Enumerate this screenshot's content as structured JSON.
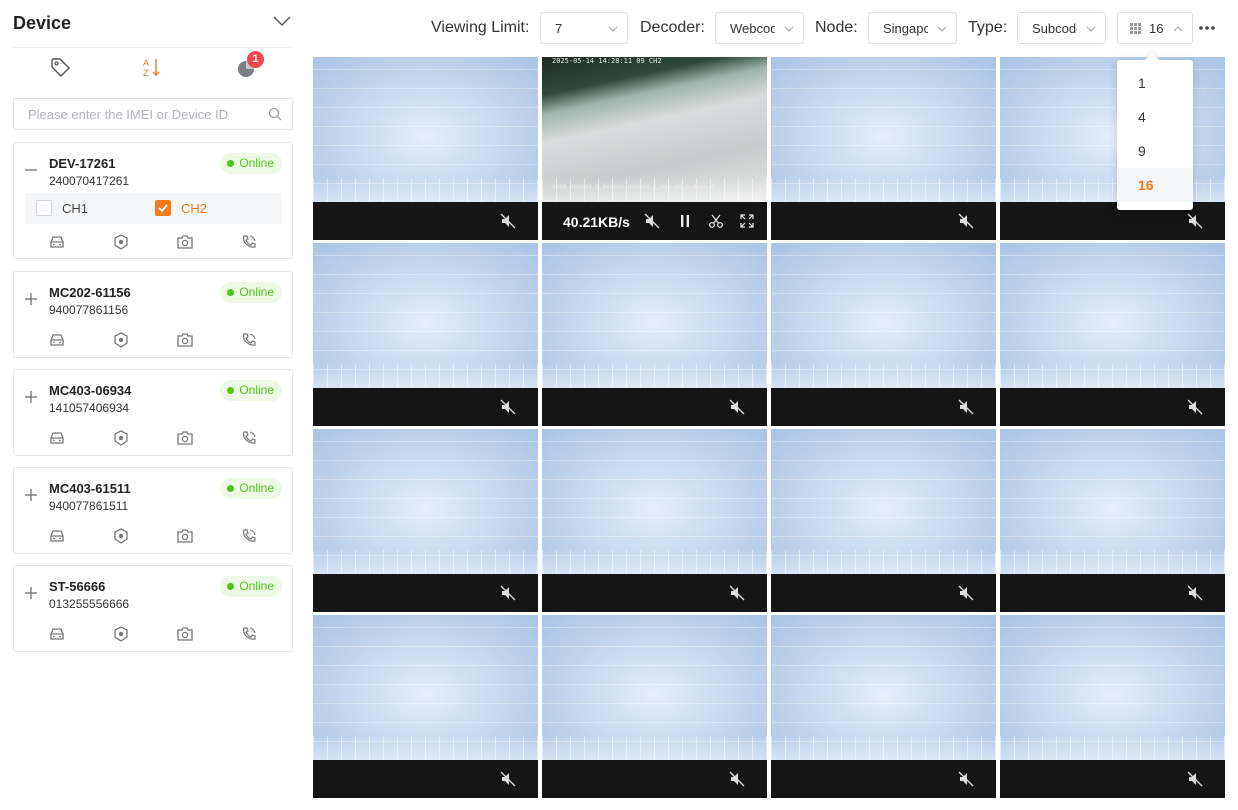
{
  "sidebar": {
    "title": "Device",
    "notification_count": "1",
    "search_placeholder": "Please enter the IMEI or Device ID",
    "devices": [
      {
        "name": "DEV-17261",
        "id": "240070417261",
        "status": "Online",
        "expanded": true,
        "channels": [
          {
            "label": "CH1",
            "checked": false
          },
          {
            "label": "CH2",
            "checked": true
          }
        ]
      },
      {
        "name": "MC202-61156",
        "id": "940077861156",
        "status": "Online",
        "expanded": false
      },
      {
        "name": "MC403-06934",
        "id": "141057406934",
        "status": "Online",
        "expanded": false
      },
      {
        "name": "MC403-61511",
        "id": "940077861511",
        "status": "Online",
        "expanded": false
      },
      {
        "name": "ST-56666",
        "id": "013255556666",
        "status": "Online",
        "expanded": false
      }
    ]
  },
  "toolbar": {
    "viewing_limit_label": "Viewing Limit:",
    "viewing_limit_value": "7",
    "decoder_label": "Decoder:",
    "decoder_value": "Webcodecs",
    "node_label": "Node:",
    "node_value": "Singapore",
    "type_label": "Type:",
    "type_value": "Subcode",
    "grid_value": "16"
  },
  "grid_dropdown": {
    "options": [
      "1",
      "4",
      "9",
      "16"
    ],
    "selected": "16"
  },
  "live_tile": {
    "osd_top": "2025-05-14 14:28:11 09  CH2",
    "osd_bottom": "0000.000000,N,000000.000000,E,000.00,0,0000,0",
    "bitrate": "40.21KB/s"
  },
  "colors": {
    "accent": "#f27a1a",
    "online": "#52c41a",
    "badge": "#f5484e"
  }
}
